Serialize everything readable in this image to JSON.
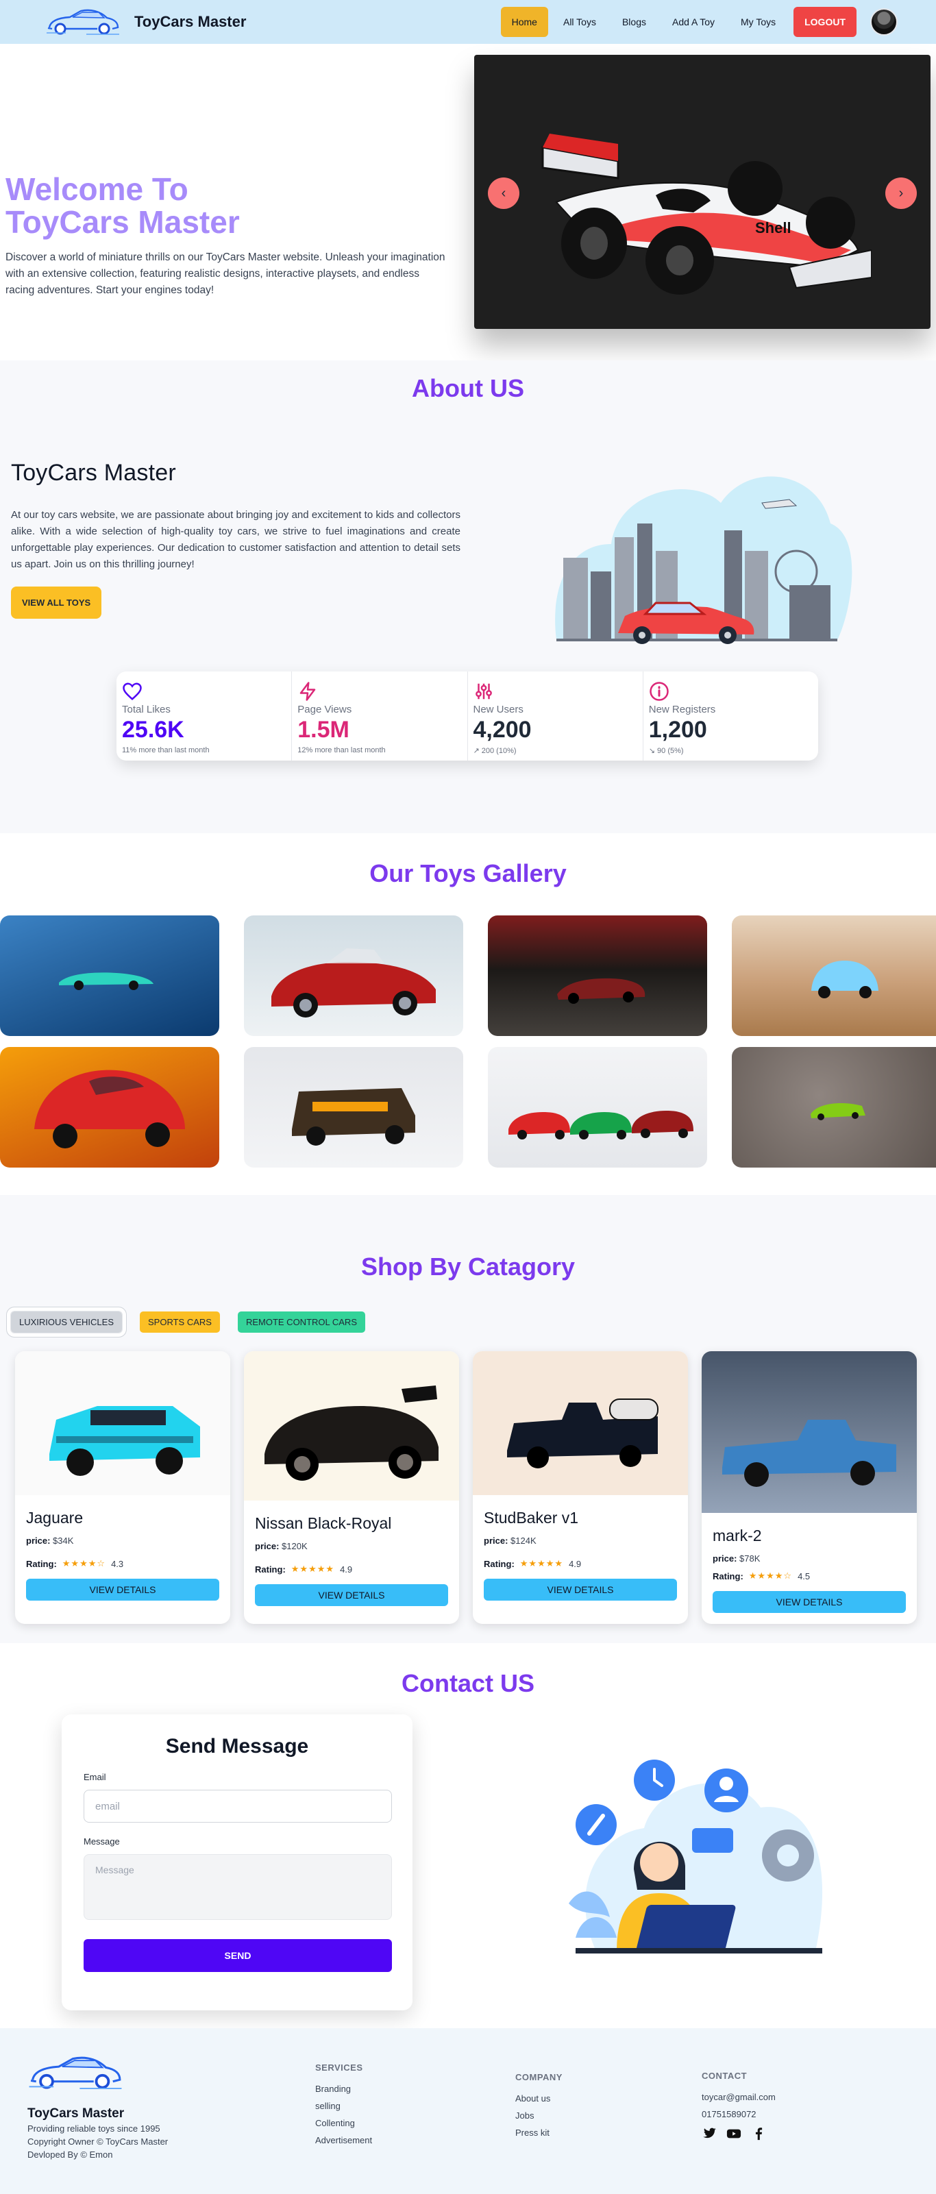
{
  "nav": {
    "brand": "ToyCars Master",
    "links": [
      "Home",
      "All Toys",
      "Blogs",
      "Add A Toy",
      "My Toys"
    ],
    "logout": "LOGOUT",
    "active_color": "#f0b429"
  },
  "hero": {
    "title_line1": "Welcome To",
    "title_line2": "ToyCars Master",
    "description": "Discover a world of miniature thrills on our ToyCars Master website. Unleash your imagination with an extensive collection, featuring realistic designs, interactive playsets, and endless racing adventures. Start your engines today!",
    "prev": "‹",
    "next": "›"
  },
  "about": {
    "heading": "About US",
    "title": "ToyCars Master",
    "text": "At our toy cars website, we are passionate about bringing joy and excitement to kids and collectors alike. With a wide selection of high-quality toy cars, we strive to fuel imaginations and create unforgettable play experiences. Our dedication to customer satisfaction and attention to detail sets us apart. Join us on this thrilling journey!",
    "button": "VIEW ALL TOYS"
  },
  "stats": [
    {
      "title": "Total Likes",
      "value": "25.6K",
      "desc": "11% more than last month",
      "color": "#4f06f5",
      "icon": "heart-icon"
    },
    {
      "title": "Page Views",
      "value": "1.5M",
      "desc": "12% more than last month",
      "color": "#db2777",
      "icon": "bolt-icon"
    },
    {
      "title": "New Users",
      "value": "4,200",
      "desc": "↗ 200 (10%)",
      "color": "#1f2937",
      "icon": "sliders-icon"
    },
    {
      "title": "New Registers",
      "value": "1,200",
      "desc": "↘ 90 (5%)",
      "color": "#1f2937",
      "icon": "info-icon"
    }
  ],
  "gallery": {
    "heading": "Our Toys Gallery"
  },
  "shop": {
    "heading": "Shop By Catagory",
    "tabs": [
      "LUXIRIOUS VEHICLES",
      "SPORTS CARS",
      "REMOTE CONTROL CARS"
    ],
    "price_label": "price:",
    "rating_label": "Rating:",
    "button": "VIEW DETAILS",
    "products": [
      {
        "name": "Jaguare",
        "price": "$34K",
        "rating": "4.3",
        "stars": "★★★★☆"
      },
      {
        "name": "Nissan Black-Royal",
        "price": "$120K",
        "rating": "4.9",
        "stars": "★★★★★"
      },
      {
        "name": "StudBaker v1",
        "price": "$124K",
        "rating": "4.9",
        "stars": "★★★★★"
      },
      {
        "name": "mark-2",
        "price": "$78K",
        "rating": "4.5",
        "stars": "★★★★☆"
      }
    ]
  },
  "contact": {
    "heading": "Contact US",
    "form_title": "Send Message",
    "email_label": "Email",
    "email_placeholder": "email",
    "message_label": "Message",
    "message_placeholder": "Message",
    "send": "SEND"
  },
  "footer": {
    "brand": "ToyCars Master",
    "tagline": "Providing reliable toys since 1995",
    "copyright": "Copyright Owner © ToyCars Master",
    "developer": "Devloped By © Emon",
    "services_head": "SERVICES",
    "services": [
      "Branding",
      "selling",
      "Collenting",
      "Advertisement"
    ],
    "company_head": "COMPANY",
    "company": [
      "About us",
      "Jobs",
      "Press kit"
    ],
    "contact_head": "CONTACT",
    "email": "toycar@gmail.com",
    "phone": "01751589072"
  }
}
